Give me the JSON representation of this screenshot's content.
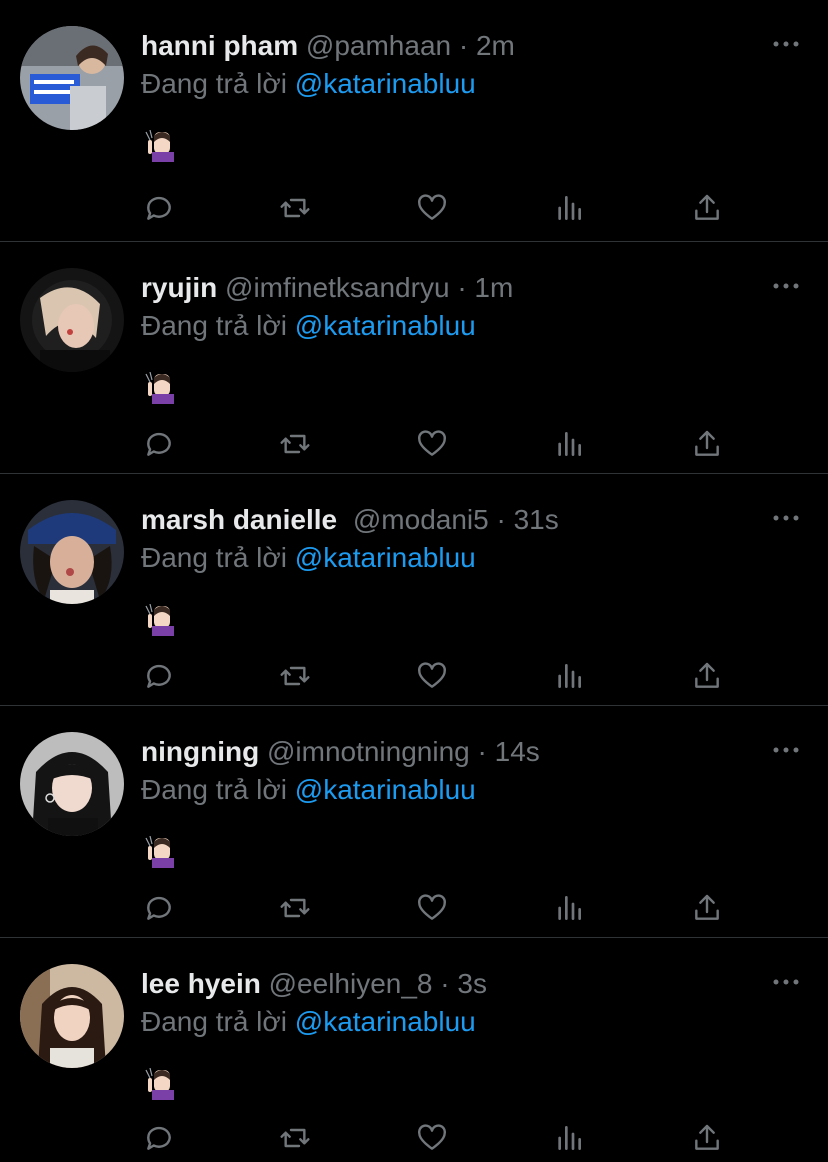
{
  "tweets": [
    {
      "name": "hanni pham",
      "handle": "@pamhaan",
      "dot": "·",
      "time": "2m",
      "reply_prefix": "Đang trả lời",
      "reply_to": "@katarinabluu",
      "emoji": "🤫"
    },
    {
      "name": "ryujin",
      "handle": "@imfinetksandryu",
      "dot": "·",
      "time": "1m",
      "reply_prefix": "Đang trả lời",
      "reply_to": "@katarinabluu",
      "emoji": "🤫"
    },
    {
      "name": "marsh danielle",
      "handle": "@modani5",
      "dot": "·",
      "time": "31s",
      "reply_prefix": "Đang trả lời",
      "reply_to": "@katarinabluu",
      "emoji": "🤫"
    },
    {
      "name": "ningning",
      "handle": "@imnotningning",
      "dot": "·",
      "time": "14s",
      "reply_prefix": "Đang trả lời",
      "reply_to": "@katarinabluu",
      "emoji": "🤫"
    },
    {
      "name": "lee hyein",
      "handle": "@eelhiyen_8",
      "dot": "·",
      "time": "3s",
      "reply_prefix": "Đang trả lời",
      "reply_to": "@katarinabluu",
      "emoji": "🤫"
    }
  ],
  "icons": {
    "more": "more-dots-icon",
    "reply": "reply-icon",
    "retweet": "retweet-icon",
    "like": "heart-icon",
    "views": "views-icon",
    "share": "share-icon"
  },
  "colors": {
    "background": "#000000",
    "text_primary": "#e7e9ea",
    "text_secondary": "#71767b",
    "accent": "#1d9bf0",
    "divider": "#2f3336"
  }
}
